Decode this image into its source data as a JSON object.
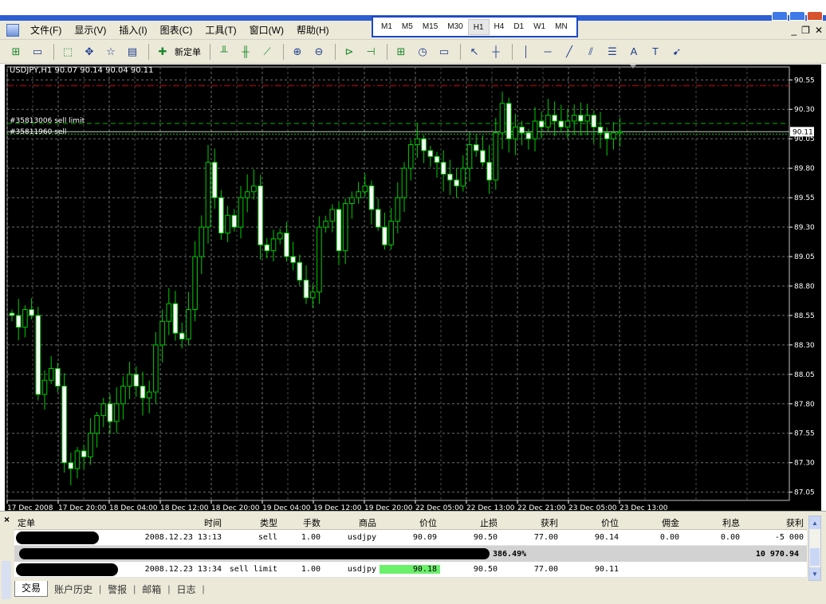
{
  "timeframes": [
    "M1",
    "M5",
    "M15",
    "M30",
    "H1",
    "H4",
    "D1",
    "W1",
    "MN"
  ],
  "active_timeframe": "H1",
  "menu": [
    "文件(F)",
    "显示(V)",
    "插入(I)",
    "图表(C)",
    "工具(T)",
    "窗口(W)",
    "帮助(H)"
  ],
  "toolbar": {
    "new_order_label": "新定单"
  },
  "chart": {
    "symbol_info": "USDJPY,H1  90.07 90.14 90.04 90.11",
    "order_label_1": "#35813006 sell limit",
    "order_label_2": "#35811960 sell",
    "current_price": "90.11",
    "colors": {
      "bull": "#000000",
      "bear": "#ffffff",
      "wick": "#00cc00",
      "grid": "#6f6f6f",
      "sell_limit_line": "#00b000",
      "sell_line": "#00d000",
      "tp_line": "#d00000",
      "bid_line": "#c8c8c8"
    }
  },
  "chart_data": {
    "type": "candlestick",
    "price_labels": [
      "90.55",
      "90.30",
      "90.05",
      "89.80",
      "89.55",
      "89.30",
      "89.05",
      "88.80",
      "88.55",
      "88.30",
      "88.05",
      "87.80",
      "87.55",
      "87.30",
      "87.05"
    ],
    "time_labels": [
      "17 Dec 2008",
      "17 Dec 20:00",
      "18 Dec 04:00",
      "18 Dec 12:00",
      "18 Dec 20:00",
      "19 Dec 04:00",
      "19 Dec 12:00",
      "19 Dec 20:00",
      "22 Dec 05:00",
      "22 Dec 13:00",
      "22 Dec 21:00",
      "23 Dec 05:00",
      "23 Dec 13:00"
    ],
    "price_range": [
      86.98,
      90.66
    ],
    "levels": {
      "take_profit": 90.5,
      "sell_limit": 90.18,
      "sell": 90.09,
      "bid": 90.11
    },
    "closes": [
      88.55,
      88.45,
      88.6,
      88.55,
      87.88,
      88.0,
      88.1,
      87.95,
      87.3,
      87.25,
      87.4,
      87.35,
      87.55,
      87.7,
      87.8,
      87.65,
      87.8,
      87.95,
      88.05,
      87.95,
      87.85,
      87.9,
      88.3,
      88.5,
      88.65,
      88.4,
      88.35,
      88.6,
      89.05,
      89.3,
      89.85,
      89.55,
      89.25,
      89.4,
      89.3,
      89.55,
      89.6,
      89.65,
      89.15,
      89.1,
      89.2,
      89.25,
      89.05,
      89.0,
      88.85,
      88.7,
      88.75,
      89.3,
      89.35,
      89.45,
      89.1,
      89.5,
      89.55,
      89.6,
      89.65,
      89.45,
      89.3,
      89.15,
      89.35,
      89.55,
      89.8,
      90.0,
      90.05,
      89.95,
      89.9,
      89.85,
      89.75,
      89.7,
      89.65,
      89.8,
      90.0,
      89.95,
      89.85,
      89.7,
      90.1,
      90.35,
      90.05,
      90.15,
      90.1,
      90.05,
      90.2,
      90.15,
      90.25,
      90.2,
      90.15,
      90.2,
      90.25,
      90.2,
      90.25,
      90.15,
      90.1,
      90.05,
      90.1,
      90.11
    ]
  },
  "terminal": {
    "headers": [
      "定单",
      "时间",
      "类型",
      "手数",
      "商品",
      "价位",
      "止损",
      "获利",
      "价位",
      "佣金",
      "利息",
      "获利"
    ],
    "rows": [
      {
        "time": "2008.12.23 13:13",
        "type": "sell",
        "lots": "1.00",
        "symbol": "usdjpy",
        "price": "90.09",
        "sl": "90.50",
        "tp": "77.00",
        "current": "90.14",
        "commission": "0.00",
        "swap": "0.00",
        "profit": "-5 000"
      },
      {
        "time": "2008.12.23 13:34",
        "type": "sell limit",
        "lots": "1.00",
        "symbol": "usdjpy",
        "price": "90.18",
        "sl": "90.50",
        "tp": "77.00",
        "current": "90.11",
        "commission": "",
        "swap": "",
        "profit": ""
      }
    ],
    "summary": {
      "margin_level": "386.49%",
      "total": "10 970.94"
    },
    "tabs": [
      "交易",
      "账户历史",
      "警报",
      "邮箱",
      "日志"
    ],
    "active_tab": "交易"
  }
}
